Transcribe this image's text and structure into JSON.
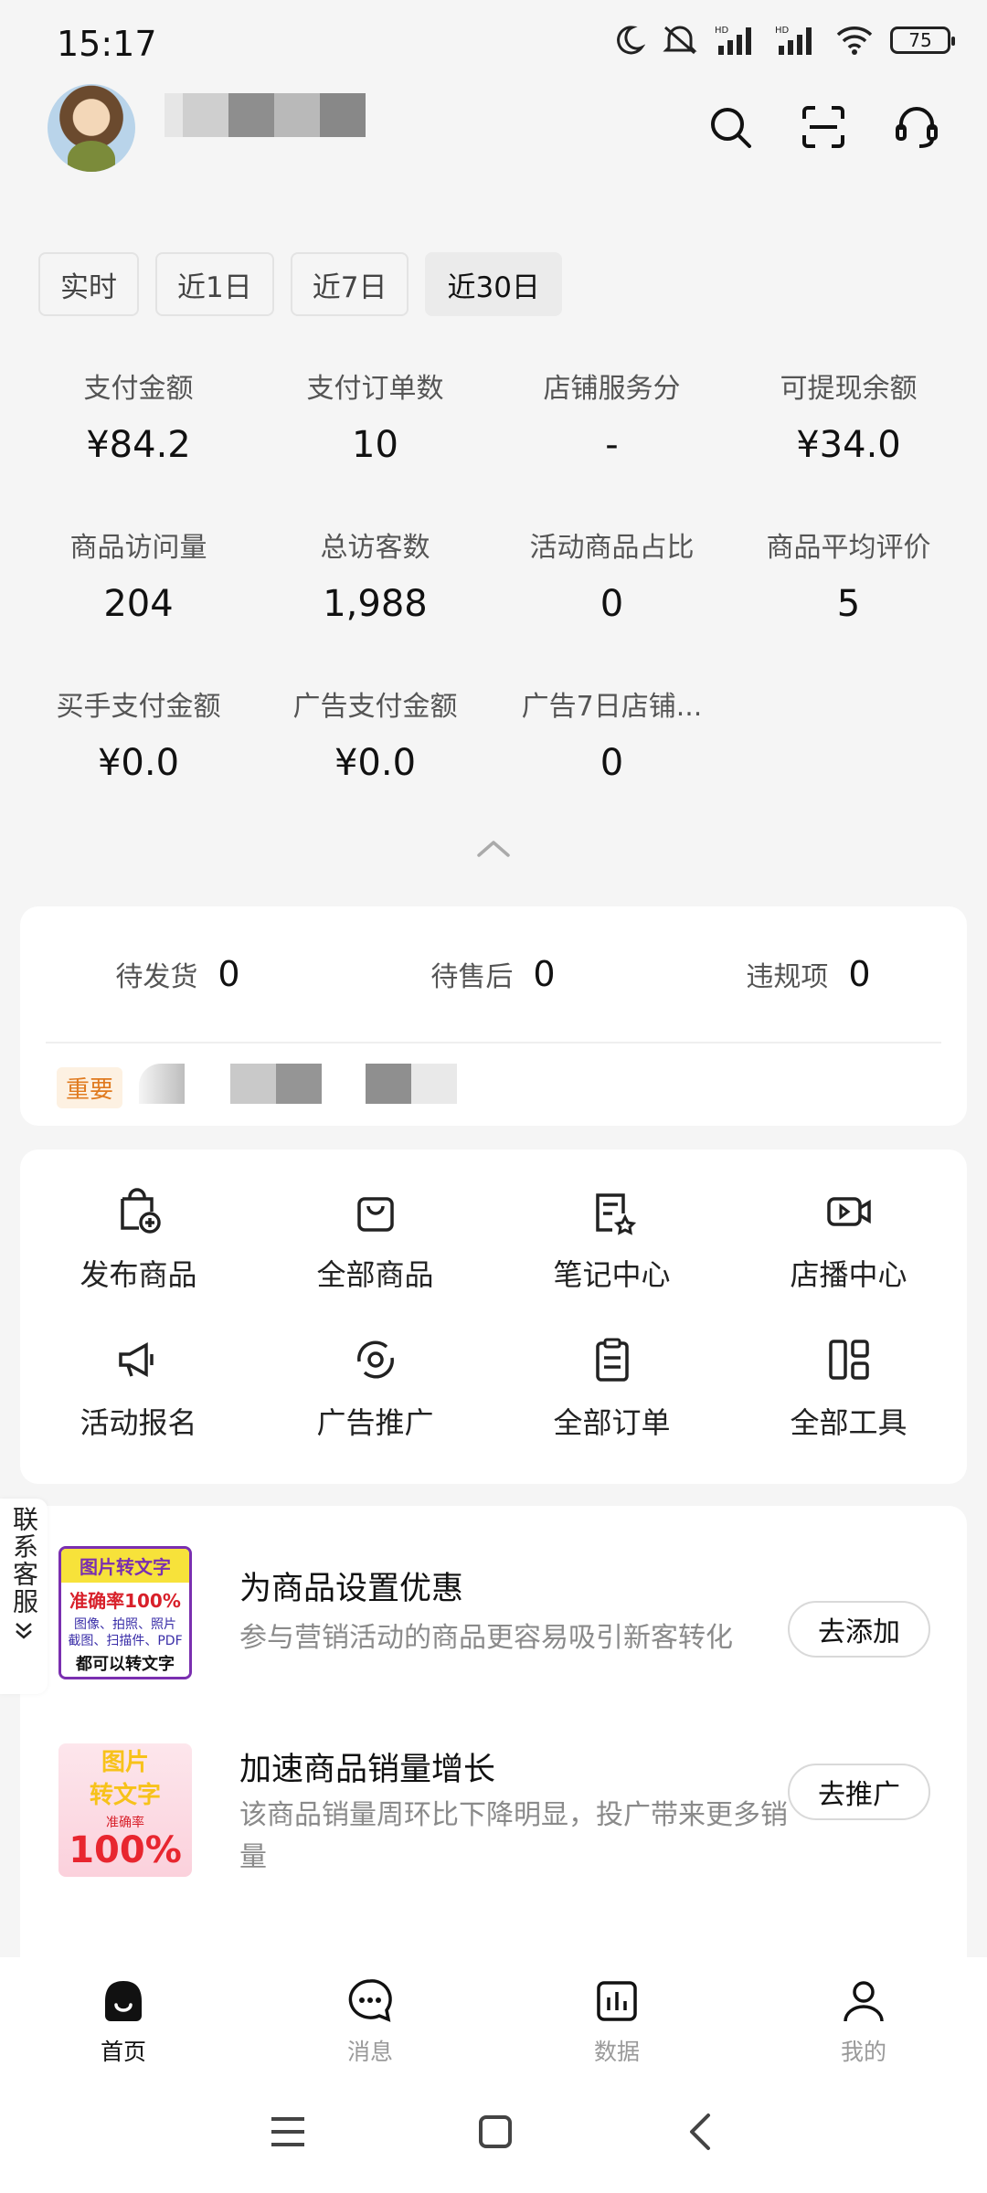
{
  "status_bar": {
    "time": "15:17",
    "battery": "75",
    "hd1": "HD",
    "hd2": "HD"
  },
  "header": {
    "icons": [
      "search-icon",
      "scan-icon",
      "customer-service-icon"
    ]
  },
  "period_tabs": [
    {
      "label": "实时",
      "active": false
    },
    {
      "label": "近1日",
      "active": false
    },
    {
      "label": "近7日",
      "active": false
    },
    {
      "label": "近30日",
      "active": true
    }
  ],
  "metrics": [
    [
      {
        "label": "支付金额",
        "value": "¥84.2"
      },
      {
        "label": "支付订单数",
        "value": "10"
      },
      {
        "label": "店铺服务分",
        "value": "-"
      },
      {
        "label": "可提现余额",
        "value": "¥34.0"
      }
    ],
    [
      {
        "label": "商品访问量",
        "value": "204"
      },
      {
        "label": "总访客数",
        "value": "1,988"
      },
      {
        "label": "活动商品占比",
        "value": "0"
      },
      {
        "label": "商品平均评价",
        "value": "5"
      }
    ],
    [
      {
        "label": "买手支付金额",
        "value": "¥0.0"
      },
      {
        "label": "广告支付金额",
        "value": "¥0.0"
      },
      {
        "label": "广告7日店铺...",
        "value": "0"
      }
    ]
  ],
  "pending": [
    {
      "label": "待发货",
      "value": "0"
    },
    {
      "label": "待售后",
      "value": "0"
    },
    {
      "label": "违规项",
      "value": "0"
    }
  ],
  "important_badge": "重要",
  "tools": [
    {
      "label": "发布商品",
      "icon": "publish-product-icon"
    },
    {
      "label": "全部商品",
      "icon": "shopping-bag-icon"
    },
    {
      "label": "笔记中心",
      "icon": "notes-icon"
    },
    {
      "label": "店播中心",
      "icon": "live-video-icon"
    },
    {
      "label": "活动报名",
      "icon": "megaphone-icon"
    },
    {
      "label": "广告推广",
      "icon": "promotion-icon"
    },
    {
      "label": "全部订单",
      "icon": "clipboard-icon"
    },
    {
      "label": "全部工具",
      "icon": "grid-tools-icon"
    }
  ],
  "promos": [
    {
      "title": "为商品设置优惠",
      "desc": "参与营销活动的商品更容易吸引新客转化",
      "button": "去添加",
      "thumb": {
        "line1": "图片转文字",
        "line2": "准确率100%",
        "line3": "图像、拍照、照片",
        "line4": "截图、扫描件、PDF",
        "line5": "都可以转文字"
      }
    },
    {
      "title": "加速商品销量增长",
      "desc": "该商品销量周环比下降明显，投广带来更多销量",
      "button": "去推广",
      "thumb": {
        "line1": "图片",
        "line2": "转文字",
        "line3": "准确率",
        "line4": "100%"
      }
    }
  ],
  "side_tab": {
    "label": "联系客服"
  },
  "bottom_nav": [
    {
      "label": "首页",
      "icon": "home-icon",
      "active": true
    },
    {
      "label": "消息",
      "icon": "message-icon",
      "active": false
    },
    {
      "label": "数据",
      "icon": "data-chart-icon",
      "active": false
    },
    {
      "label": "我的",
      "icon": "profile-icon",
      "active": false
    }
  ],
  "colors": {
    "background": "#f5f5f5",
    "card": "#ffffff",
    "badge_text": "#e07a1f",
    "badge_bg": "#fdf1e2",
    "muted_text": "#8a8a8a"
  }
}
